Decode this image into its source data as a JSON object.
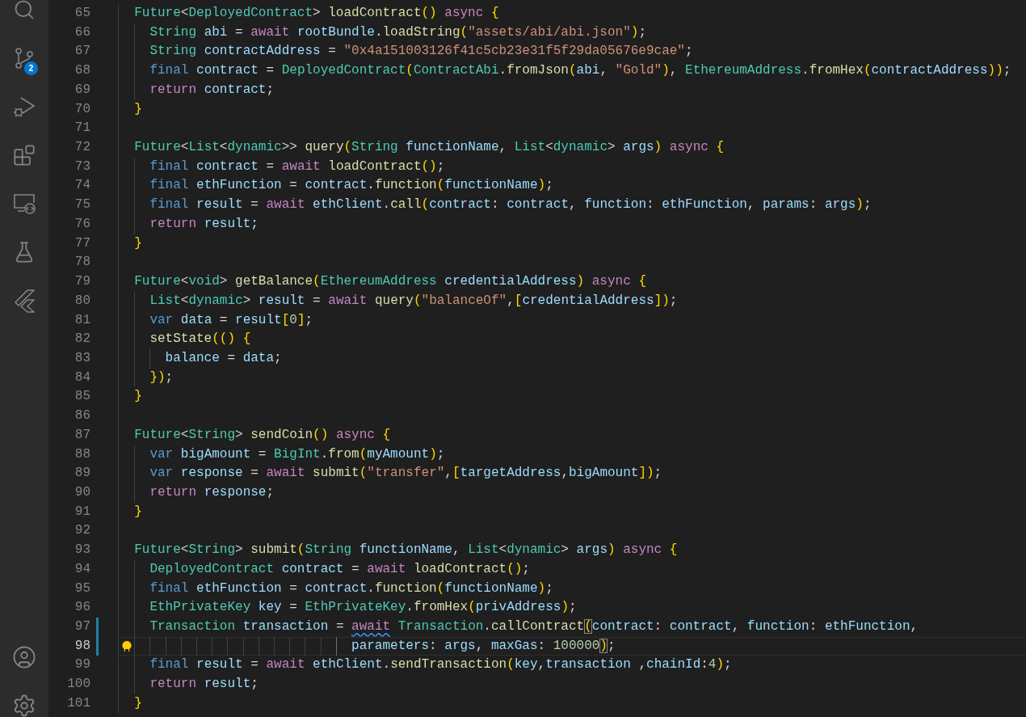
{
  "activity_bar": {
    "top_items": [
      {
        "kind": "search"
      },
      {
        "kind": "source-control",
        "badge": "2"
      },
      {
        "kind": "run-debug"
      },
      {
        "kind": "extensions"
      },
      {
        "kind": "remote"
      },
      {
        "kind": "testing"
      },
      {
        "kind": "flutter"
      }
    ],
    "bottom_items": [
      {
        "kind": "account"
      },
      {
        "kind": "settings"
      }
    ]
  },
  "editor": {
    "lines": [
      {
        "number": "65",
        "current": false,
        "modified": false,
        "lightbulb": false,
        "tokens": [
          {
            "kind": "type",
            "text": "  Future"
          },
          {
            "kind": "punc",
            "text": "<"
          },
          {
            "kind": "type",
            "text": "DeployedContract"
          },
          {
            "kind": "punc",
            "text": "> "
          },
          {
            "kind": "fn",
            "text": "loadContract"
          },
          {
            "kind": "brk",
            "text": "() "
          },
          {
            "kind": "ctl",
            "text": "async "
          },
          {
            "kind": "brk",
            "text": "{"
          }
        ]
      },
      {
        "number": "66",
        "current": false,
        "modified": false,
        "lightbulb": false,
        "tokens": [
          {
            "kind": "type",
            "text": "    String "
          },
          {
            "kind": "var",
            "text": "abi "
          },
          {
            "kind": "punc",
            "text": "= "
          },
          {
            "kind": "ctl",
            "text": "await "
          },
          {
            "kind": "var",
            "text": "rootBundle"
          },
          {
            "kind": "punc",
            "text": "."
          },
          {
            "kind": "fn",
            "text": "loadString"
          },
          {
            "kind": "brk",
            "text": "("
          },
          {
            "kind": "str",
            "text": "\"assets/abi/abi.json\""
          },
          {
            "kind": "brk",
            "text": ")"
          },
          {
            "kind": "punc",
            "text": ";"
          }
        ]
      },
      {
        "number": "67",
        "current": false,
        "modified": false,
        "lightbulb": false,
        "tokens": [
          {
            "kind": "type",
            "text": "    String "
          },
          {
            "kind": "var",
            "text": "contractAddress "
          },
          {
            "kind": "punc",
            "text": "= "
          },
          {
            "kind": "str",
            "text": "\"0x4a151003126f41c5cb23e31f5f29da05676e9cae\""
          },
          {
            "kind": "punc",
            "text": ";"
          }
        ]
      },
      {
        "number": "68",
        "current": false,
        "modified": false,
        "lightbulb": false,
        "tokens": [
          {
            "kind": "kw",
            "text": "    final "
          },
          {
            "kind": "var",
            "text": "contract "
          },
          {
            "kind": "punc",
            "text": "= "
          },
          {
            "kind": "type",
            "text": "DeployedContract"
          },
          {
            "kind": "brk",
            "text": "("
          },
          {
            "kind": "type",
            "text": "ContractAbi"
          },
          {
            "kind": "punc",
            "text": "."
          },
          {
            "kind": "fn",
            "text": "fromJson"
          },
          {
            "kind": "brk",
            "text": "("
          },
          {
            "kind": "var",
            "text": "abi"
          },
          {
            "kind": "punc",
            "text": ", "
          },
          {
            "kind": "str",
            "text": "\"Gold\""
          },
          {
            "kind": "brk",
            "text": ")"
          },
          {
            "kind": "punc",
            "text": ", "
          },
          {
            "kind": "type",
            "text": "EthereumAddress"
          },
          {
            "kind": "punc",
            "text": "."
          },
          {
            "kind": "fn",
            "text": "fromHex"
          },
          {
            "kind": "brk",
            "text": "("
          },
          {
            "kind": "var",
            "text": "contractAddress"
          },
          {
            "kind": "brk",
            "text": "))"
          },
          {
            "kind": "punc",
            "text": ";"
          }
        ]
      },
      {
        "number": "69",
        "current": false,
        "modified": false,
        "lightbulb": false,
        "tokens": [
          {
            "kind": "ctl",
            "text": "    return "
          },
          {
            "kind": "var",
            "text": "contract"
          },
          {
            "kind": "punc",
            "text": ";"
          }
        ]
      },
      {
        "number": "70",
        "current": false,
        "modified": false,
        "lightbulb": false,
        "tokens": [
          {
            "kind": "brk",
            "text": "  }"
          }
        ]
      },
      {
        "number": "71",
        "current": false,
        "modified": false,
        "lightbulb": false
      },
      {
        "number": "72",
        "current": false,
        "modified": false,
        "lightbulb": false,
        "tokens": [
          {
            "kind": "type",
            "text": "  Future"
          },
          {
            "kind": "punc",
            "text": "<"
          },
          {
            "kind": "type",
            "text": "List"
          },
          {
            "kind": "punc",
            "text": "<"
          },
          {
            "kind": "type",
            "text": "dynamic"
          },
          {
            "kind": "punc",
            "text": ">> "
          },
          {
            "kind": "fn",
            "text": "query"
          },
          {
            "kind": "brk",
            "text": "("
          },
          {
            "kind": "type",
            "text": "String "
          },
          {
            "kind": "var",
            "text": "functionName"
          },
          {
            "kind": "punc",
            "text": ", "
          },
          {
            "kind": "type",
            "text": "List"
          },
          {
            "kind": "punc",
            "text": "<"
          },
          {
            "kind": "type",
            "text": "dynamic"
          },
          {
            "kind": "punc",
            "text": "> "
          },
          {
            "kind": "var",
            "text": "args"
          },
          {
            "kind": "brk",
            "text": ") "
          },
          {
            "kind": "ctl",
            "text": "async "
          },
          {
            "kind": "brk",
            "text": "{"
          }
        ]
      },
      {
        "number": "73",
        "current": false,
        "modified": false,
        "lightbulb": false,
        "tokens": [
          {
            "kind": "kw",
            "text": "    final "
          },
          {
            "kind": "var",
            "text": "contract "
          },
          {
            "kind": "punc",
            "text": "= "
          },
          {
            "kind": "ctl",
            "text": "await "
          },
          {
            "kind": "fn",
            "text": "loadContract"
          },
          {
            "kind": "brk",
            "text": "()"
          },
          {
            "kind": "punc",
            "text": ";"
          }
        ]
      },
      {
        "number": "74",
        "current": false,
        "modified": false,
        "lightbulb": false,
        "tokens": [
          {
            "kind": "kw",
            "text": "    final "
          },
          {
            "kind": "var",
            "text": "ethFunction "
          },
          {
            "kind": "punc",
            "text": "= "
          },
          {
            "kind": "var",
            "text": "contract"
          },
          {
            "kind": "punc",
            "text": "."
          },
          {
            "kind": "fn",
            "text": "function"
          },
          {
            "kind": "brk",
            "text": "("
          },
          {
            "kind": "var",
            "text": "functionName"
          },
          {
            "kind": "brk",
            "text": ")"
          },
          {
            "kind": "punc",
            "text": ";"
          }
        ]
      },
      {
        "number": "75",
        "current": false,
        "modified": false,
        "lightbulb": false,
        "tokens": [
          {
            "kind": "kw",
            "text": "    final "
          },
          {
            "kind": "var",
            "text": "result "
          },
          {
            "kind": "punc",
            "text": "= "
          },
          {
            "kind": "ctl",
            "text": "await "
          },
          {
            "kind": "var",
            "text": "ethClient"
          },
          {
            "kind": "punc",
            "text": "."
          },
          {
            "kind": "fn",
            "text": "call"
          },
          {
            "kind": "brk",
            "text": "("
          },
          {
            "kind": "var",
            "text": "contract"
          },
          {
            "kind": "punc",
            "text": ": "
          },
          {
            "kind": "var",
            "text": "contract"
          },
          {
            "kind": "punc",
            "text": ", "
          },
          {
            "kind": "var",
            "text": "function"
          },
          {
            "kind": "punc",
            "text": ": "
          },
          {
            "kind": "var",
            "text": "ethFunction"
          },
          {
            "kind": "punc",
            "text": ", "
          },
          {
            "kind": "var",
            "text": "params"
          },
          {
            "kind": "punc",
            "text": ": "
          },
          {
            "kind": "var",
            "text": "args"
          },
          {
            "kind": "brk",
            "text": ")"
          },
          {
            "kind": "punc",
            "text": ";"
          }
        ]
      },
      {
        "number": "76",
        "current": false,
        "modified": false,
        "lightbulb": false,
        "tokens": [
          {
            "kind": "ctl",
            "text": "    return "
          },
          {
            "kind": "var",
            "text": "result"
          },
          {
            "kind": "punc",
            "text": ";"
          }
        ]
      },
      {
        "number": "77",
        "current": false,
        "modified": false,
        "lightbulb": false,
        "tokens": [
          {
            "kind": "brk",
            "text": "  }"
          }
        ]
      },
      {
        "number": "78",
        "current": false,
        "modified": false,
        "lightbulb": false
      },
      {
        "number": "79",
        "current": false,
        "modified": false,
        "lightbulb": false,
        "tokens": [
          {
            "kind": "type",
            "text": "  Future"
          },
          {
            "kind": "punc",
            "text": "<"
          },
          {
            "kind": "type",
            "text": "void"
          },
          {
            "kind": "punc",
            "text": "> "
          },
          {
            "kind": "fn",
            "text": "getBalance"
          },
          {
            "kind": "brk",
            "text": "("
          },
          {
            "kind": "type",
            "text": "EthereumAddress "
          },
          {
            "kind": "var",
            "text": "credentialAddress"
          },
          {
            "kind": "brk",
            "text": ") "
          },
          {
            "kind": "ctl",
            "text": "async "
          },
          {
            "kind": "brk",
            "text": "{"
          }
        ]
      },
      {
        "number": "80",
        "current": false,
        "modified": false,
        "lightbulb": false,
        "tokens": [
          {
            "kind": "type",
            "text": "    List"
          },
          {
            "kind": "punc",
            "text": "<"
          },
          {
            "kind": "type",
            "text": "dynamic"
          },
          {
            "kind": "punc",
            "text": "> "
          },
          {
            "kind": "var",
            "text": "result "
          },
          {
            "kind": "punc",
            "text": "= "
          },
          {
            "kind": "ctl",
            "text": "await "
          },
          {
            "kind": "fn",
            "text": "query"
          },
          {
            "kind": "brk",
            "text": "("
          },
          {
            "kind": "str",
            "text": "\"balanceOf\""
          },
          {
            "kind": "punc",
            "text": ","
          },
          {
            "kind": "brk",
            "text": "["
          },
          {
            "kind": "var",
            "text": "credentialAddress"
          },
          {
            "kind": "brk",
            "text": "])"
          },
          {
            "kind": "punc",
            "text": ";"
          }
        ]
      },
      {
        "number": "81",
        "current": false,
        "modified": false,
        "lightbulb": false,
        "tokens": [
          {
            "kind": "kw",
            "text": "    var "
          },
          {
            "kind": "var",
            "text": "data "
          },
          {
            "kind": "punc",
            "text": "= "
          },
          {
            "kind": "var",
            "text": "result"
          },
          {
            "kind": "brk",
            "text": "["
          },
          {
            "kind": "num",
            "text": "0"
          },
          {
            "kind": "brk",
            "text": "]"
          },
          {
            "kind": "punc",
            "text": ";"
          }
        ]
      },
      {
        "number": "82",
        "current": false,
        "modified": false,
        "lightbulb": false,
        "tokens": [
          {
            "kind": "fn",
            "text": "    setState"
          },
          {
            "kind": "brk",
            "text": "(() {"
          }
        ]
      },
      {
        "number": "83",
        "current": false,
        "modified": false,
        "lightbulb": false,
        "tokens": [
          {
            "kind": "var",
            "text": "      balance "
          },
          {
            "kind": "punc",
            "text": "= "
          },
          {
            "kind": "var",
            "text": "data"
          },
          {
            "kind": "punc",
            "text": ";"
          }
        ]
      },
      {
        "number": "84",
        "current": false,
        "modified": false,
        "lightbulb": false,
        "tokens": [
          {
            "kind": "brk",
            "text": "    })"
          },
          {
            "kind": "punc",
            "text": ";"
          }
        ]
      },
      {
        "number": "85",
        "current": false,
        "modified": false,
        "lightbulb": false,
        "tokens": [
          {
            "kind": "brk",
            "text": "  }"
          }
        ]
      },
      {
        "number": "86",
        "current": false,
        "modified": false,
        "lightbulb": false
      },
      {
        "number": "87",
        "current": false,
        "modified": false,
        "lightbulb": false,
        "tokens": [
          {
            "kind": "type",
            "text": "  Future"
          },
          {
            "kind": "punc",
            "text": "<"
          },
          {
            "kind": "type",
            "text": "String"
          },
          {
            "kind": "punc",
            "text": "> "
          },
          {
            "kind": "fn",
            "text": "sendCoin"
          },
          {
            "kind": "brk",
            "text": "() "
          },
          {
            "kind": "ctl",
            "text": "async "
          },
          {
            "kind": "brk",
            "text": "{"
          }
        ]
      },
      {
        "number": "88",
        "current": false,
        "modified": false,
        "lightbulb": false,
        "tokens": [
          {
            "kind": "kw",
            "text": "    var "
          },
          {
            "kind": "var",
            "text": "bigAmount "
          },
          {
            "kind": "punc",
            "text": "= "
          },
          {
            "kind": "type",
            "text": "BigInt"
          },
          {
            "kind": "punc",
            "text": "."
          },
          {
            "kind": "fn",
            "text": "from"
          },
          {
            "kind": "brk",
            "text": "("
          },
          {
            "kind": "var",
            "text": "myAmount"
          },
          {
            "kind": "brk",
            "text": ")"
          },
          {
            "kind": "punc",
            "text": ";"
          }
        ]
      },
      {
        "number": "89",
        "current": false,
        "modified": false,
        "lightbulb": false,
        "tokens": [
          {
            "kind": "kw",
            "text": "    var "
          },
          {
            "kind": "var",
            "text": "response "
          },
          {
            "kind": "punc",
            "text": "= "
          },
          {
            "kind": "ctl",
            "text": "await "
          },
          {
            "kind": "fn",
            "text": "submit"
          },
          {
            "kind": "brk",
            "text": "("
          },
          {
            "kind": "str",
            "text": "\"transfer\""
          },
          {
            "kind": "punc",
            "text": ","
          },
          {
            "kind": "brk",
            "text": "["
          },
          {
            "kind": "var",
            "text": "targetAddress"
          },
          {
            "kind": "punc",
            "text": ","
          },
          {
            "kind": "var",
            "text": "bigAmount"
          },
          {
            "kind": "brk",
            "text": "])"
          },
          {
            "kind": "punc",
            "text": ";"
          }
        ]
      },
      {
        "number": "90",
        "current": false,
        "modified": false,
        "lightbulb": false,
        "tokens": [
          {
            "kind": "ctl",
            "text": "    return "
          },
          {
            "kind": "var",
            "text": "response"
          },
          {
            "kind": "punc",
            "text": ";"
          }
        ]
      },
      {
        "number": "91",
        "current": false,
        "modified": false,
        "lightbulb": false,
        "tokens": [
          {
            "kind": "brk",
            "text": "  }"
          }
        ]
      },
      {
        "number": "92",
        "current": false,
        "modified": false,
        "lightbulb": false
      },
      {
        "number": "93",
        "current": false,
        "modified": false,
        "lightbulb": false,
        "tokens": [
          {
            "kind": "type",
            "text": "  Future"
          },
          {
            "kind": "punc",
            "text": "<"
          },
          {
            "kind": "type",
            "text": "String"
          },
          {
            "kind": "punc",
            "text": "> "
          },
          {
            "kind": "fn",
            "text": "submit"
          },
          {
            "kind": "brk",
            "text": "("
          },
          {
            "kind": "type",
            "text": "String "
          },
          {
            "kind": "var",
            "text": "functionName"
          },
          {
            "kind": "punc",
            "text": ", "
          },
          {
            "kind": "type",
            "text": "List"
          },
          {
            "kind": "punc",
            "text": "<"
          },
          {
            "kind": "type",
            "text": "dynamic"
          },
          {
            "kind": "punc",
            "text": "> "
          },
          {
            "kind": "var",
            "text": "args"
          },
          {
            "kind": "brk",
            "text": ") "
          },
          {
            "kind": "ctl",
            "text": "async "
          },
          {
            "kind": "brk",
            "text": "{"
          }
        ]
      },
      {
        "number": "94",
        "current": false,
        "modified": false,
        "lightbulb": false,
        "tokens": [
          {
            "kind": "type",
            "text": "    DeployedContract "
          },
          {
            "kind": "var",
            "text": "contract "
          },
          {
            "kind": "punc",
            "text": "= "
          },
          {
            "kind": "ctl",
            "text": "await "
          },
          {
            "kind": "fn",
            "text": "loadContract"
          },
          {
            "kind": "brk",
            "text": "()"
          },
          {
            "kind": "punc",
            "text": ";"
          }
        ]
      },
      {
        "number": "95",
        "current": false,
        "modified": false,
        "lightbulb": false,
        "tokens": [
          {
            "kind": "kw",
            "text": "    final "
          },
          {
            "kind": "var",
            "text": "ethFunction "
          },
          {
            "kind": "punc",
            "text": "= "
          },
          {
            "kind": "var",
            "text": "contract"
          },
          {
            "kind": "punc",
            "text": "."
          },
          {
            "kind": "fn",
            "text": "function"
          },
          {
            "kind": "brk",
            "text": "("
          },
          {
            "kind": "var",
            "text": "functionName"
          },
          {
            "kind": "brk",
            "text": ")"
          },
          {
            "kind": "punc",
            "text": ";"
          }
        ]
      },
      {
        "number": "96",
        "current": false,
        "modified": false,
        "lightbulb": false,
        "tokens": [
          {
            "kind": "type",
            "text": "    EthPrivateKey "
          },
          {
            "kind": "var",
            "text": "key "
          },
          {
            "kind": "punc",
            "text": "= "
          },
          {
            "kind": "type",
            "text": "EthPrivateKey"
          },
          {
            "kind": "punc",
            "text": "."
          },
          {
            "kind": "fn",
            "text": "fromHex"
          },
          {
            "kind": "brk",
            "text": "("
          },
          {
            "kind": "var",
            "text": "privAddress"
          },
          {
            "kind": "brk",
            "text": ")"
          },
          {
            "kind": "punc",
            "text": ";"
          }
        ]
      },
      {
        "number": "97",
        "current": false,
        "modified": true,
        "lightbulb": false,
        "tokens": [
          {
            "kind": "type",
            "text": "    Transaction "
          },
          {
            "kind": "var",
            "text": "transaction "
          },
          {
            "kind": "punc",
            "text": "= "
          },
          {
            "kind": "ctl-warn",
            "text": "await"
          },
          {
            "kind": "type",
            "text": " Transaction"
          },
          {
            "kind": "punc",
            "text": "."
          },
          {
            "kind": "fn",
            "text": "callContract"
          },
          {
            "kind": "brk-match",
            "text": "("
          },
          {
            "kind": "var",
            "text": "contract"
          },
          {
            "kind": "punc",
            "text": ": "
          },
          {
            "kind": "var",
            "text": "contract"
          },
          {
            "kind": "punc",
            "text": ", "
          },
          {
            "kind": "var",
            "text": "function"
          },
          {
            "kind": "punc",
            "text": ": "
          },
          {
            "kind": "var",
            "text": "ethFunction"
          },
          {
            "kind": "punc",
            "text": ","
          }
        ]
      },
      {
        "number": "98",
        "current": true,
        "modified": true,
        "lightbulb": true,
        "tokens": [
          {
            "kind": "var",
            "text": "                              parameters"
          },
          {
            "kind": "punc",
            "text": ": "
          },
          {
            "kind": "var",
            "text": "args"
          },
          {
            "kind": "punc",
            "text": ", "
          },
          {
            "kind": "var",
            "text": "maxGas"
          },
          {
            "kind": "punc",
            "text": ": "
          },
          {
            "kind": "num",
            "text": "100000"
          },
          {
            "kind": "brk-match",
            "text": ")"
          },
          {
            "kind": "punc",
            "text": ";"
          }
        ]
      },
      {
        "number": "99",
        "current": false,
        "modified": false,
        "lightbulb": false,
        "tokens": [
          {
            "kind": "kw",
            "text": "    final "
          },
          {
            "kind": "var",
            "text": "result "
          },
          {
            "kind": "punc",
            "text": "= "
          },
          {
            "kind": "ctl",
            "text": "await "
          },
          {
            "kind": "var",
            "text": "ethClient"
          },
          {
            "kind": "punc",
            "text": "."
          },
          {
            "kind": "fn",
            "text": "sendTransaction"
          },
          {
            "kind": "brk",
            "text": "("
          },
          {
            "kind": "var",
            "text": "key"
          },
          {
            "kind": "punc",
            "text": ","
          },
          {
            "kind": "var",
            "text": "transaction "
          },
          {
            "kind": "punc",
            "text": ","
          },
          {
            "kind": "var",
            "text": "chainId"
          },
          {
            "kind": "punc",
            "text": ":"
          },
          {
            "kind": "num",
            "text": "4"
          },
          {
            "kind": "brk",
            "text": ")"
          },
          {
            "kind": "punc",
            "text": ";"
          }
        ]
      },
      {
        "number": "100",
        "current": false,
        "modified": false,
        "lightbulb": false,
        "tokens": [
          {
            "kind": "ctl",
            "text": "    return "
          },
          {
            "kind": "var",
            "text": "result"
          },
          {
            "kind": "punc",
            "text": ";"
          }
        ]
      },
      {
        "number": "101",
        "current": false,
        "modified": false,
        "lightbulb": false,
        "tokens": [
          {
            "kind": "brk",
            "text": "  }"
          }
        ]
      }
    ]
  }
}
